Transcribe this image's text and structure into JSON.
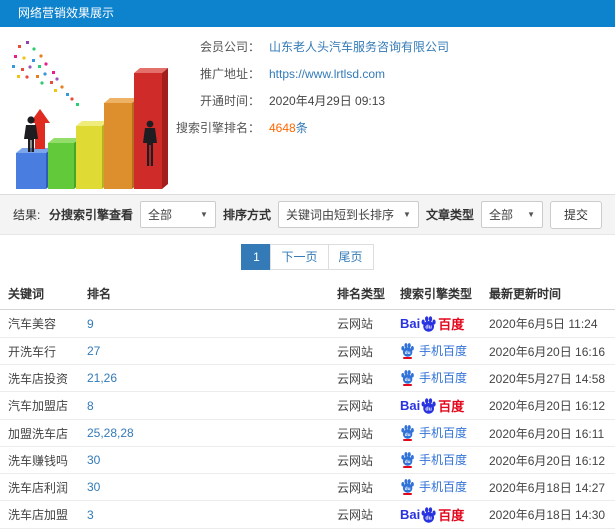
{
  "header": {
    "title": "网络营销效果展示"
  },
  "info": {
    "company_label": "会员公司：",
    "company_value": "山东老人头汽车服务咨询有限公司",
    "url_label": "推广地址：",
    "url_value": "https://www.lrtlsd.com",
    "open_time_label": "开通时间：",
    "open_time_value": "2020年4月29日 09:13",
    "rank_label": "搜索引擎排名：",
    "rank_count": "4648",
    "rank_unit": "条"
  },
  "filters": {
    "result_label": "结果:",
    "engine_filter_label": "分搜索引擎查看",
    "engine_filter_value": "全部",
    "sort_label": "排序方式",
    "sort_value": "关键词由短到长排序",
    "article_type_label": "文章类型",
    "article_type_value": "全部",
    "submit_label": "提交"
  },
  "pagination": {
    "current": "1",
    "next": "下一页",
    "last": "尾页"
  },
  "table": {
    "headers": [
      "关键词",
      "排名",
      "排名类型",
      "搜索引擎类型",
      "最新更新时间"
    ],
    "engine_labels": {
      "baidu_prefix": "Bai",
      "baidu_du": "du",
      "baidu_cn": "百度",
      "mobile": "手机百度"
    },
    "rows": [
      {
        "keyword": "汽车美容",
        "rank": "9",
        "rank_type": "云网站",
        "engine": "baidu",
        "updated": "2020年6月5日 11:24"
      },
      {
        "keyword": "开洗车行",
        "rank": "27",
        "rank_type": "云网站",
        "engine": "mobile-baidu",
        "updated": "2020年6月20日 16:16"
      },
      {
        "keyword": "洗车店投资",
        "rank": "21,26",
        "rank_type": "云网站",
        "engine": "mobile-baidu",
        "updated": "2020年5月27日 14:58"
      },
      {
        "keyword": "汽车加盟店",
        "rank": "8",
        "rank_type": "云网站",
        "engine": "baidu",
        "updated": "2020年6月20日 16:12"
      },
      {
        "keyword": "加盟洗车店",
        "rank": "25,28,28",
        "rank_type": "云网站",
        "engine": "mobile-baidu",
        "updated": "2020年6月20日 16:11"
      },
      {
        "keyword": "洗车赚钱吗",
        "rank": "30",
        "rank_type": "云网站",
        "engine": "mobile-baidu",
        "updated": "2020年6月20日 16:12"
      },
      {
        "keyword": "洗车店利润",
        "rank": "30",
        "rank_type": "云网站",
        "engine": "mobile-baidu",
        "updated": "2020年6月18日 14:27"
      },
      {
        "keyword": "洗车店加盟",
        "rank": "3",
        "rank_type": "云网站",
        "engine": "baidu",
        "updated": "2020年6月18日 14:30"
      }
    ]
  },
  "colors": {
    "header_bg": "#0d82cd",
    "link_blue": "#337ab7",
    "highlight_orange": "#ff6600",
    "baidu_blue": "#2932e1",
    "baidu_red": "#e3071d",
    "mobile_baidu_blue": "#3072d8",
    "active_page_bg": "#337ab7",
    "filter_band_bg": "#f4f4f4"
  }
}
